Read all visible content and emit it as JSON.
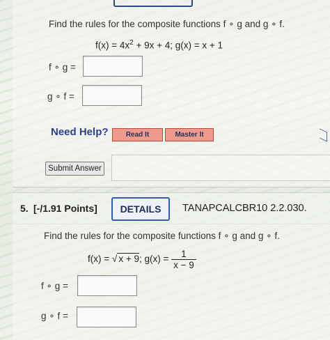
{
  "question4": {
    "prompt": "Find the rules for the composite functions f ∘ g and g ∘ f.",
    "formula": {
      "f_prefix": "f(x) = 4x",
      "f_exp": "2",
      "f_suffix": " + 9x + 4; g(x) = x + 1"
    },
    "fog_label": "f ∘ g =",
    "gof_label": "g ∘ f =",
    "fog_value": "",
    "gof_value": "",
    "need_help": "Need Help?",
    "read_it": "Read It",
    "master_it": "Master It",
    "submit": "Submit Answer"
  },
  "question5": {
    "number": "5.",
    "points": "[-/1.91 Points]",
    "details": "DETAILS",
    "code": "TANAPCALCBR10 2.2.030.",
    "prompt": "Find the rules for the composite functions f ∘ g and g ∘ f.",
    "formula": {
      "f_prefix": "f(x) = ",
      "sqrt_symbol": "√",
      "sqrt_content": "x + 9",
      "g_prefix": "; g(x) = ",
      "g_num": "1",
      "g_den": "x − 9"
    },
    "fog_label": "f ∘ g =",
    "gof_label": "g ∘ f =",
    "fog_value": "",
    "gof_value": ""
  }
}
